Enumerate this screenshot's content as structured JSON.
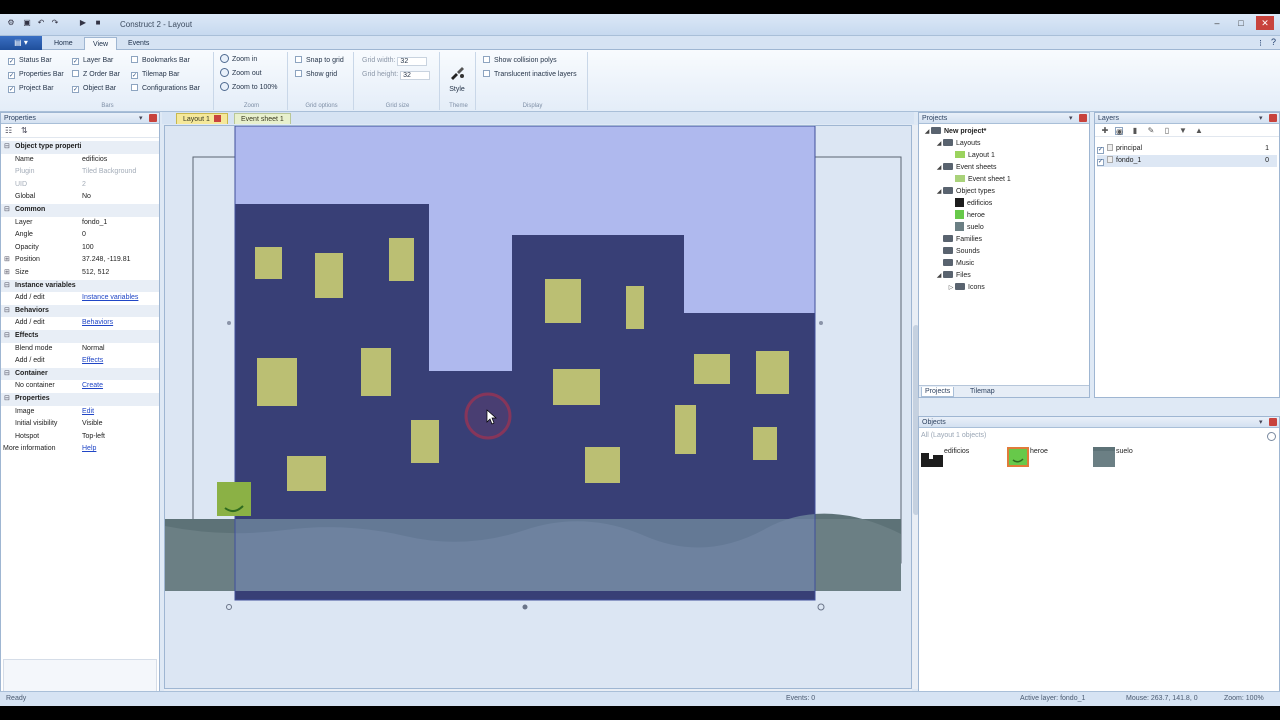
{
  "window": {
    "title": "Construct 2 - Layout"
  },
  "ribbon": {
    "tabs": [
      "Home",
      "View",
      "Events"
    ],
    "active_tab": "View",
    "groups": {
      "bars": {
        "title": "Bars",
        "items": [
          {
            "label": "Status Bar",
            "checked": true
          },
          {
            "label": "Layer Bar",
            "checked": true
          },
          {
            "label": "Bookmarks Bar",
            "checked": false
          },
          {
            "label": "Properties Bar",
            "checked": true
          },
          {
            "label": "Z Order Bar",
            "checked": false
          },
          {
            "label": "Tilemap Bar",
            "checked": true
          },
          {
            "label": "Project Bar",
            "checked": true
          },
          {
            "label": "Object Bar",
            "checked": true
          },
          {
            "label": "Configurations Bar",
            "checked": false
          }
        ]
      },
      "zoom": {
        "title": "Zoom",
        "items": [
          "Zoom in",
          "Zoom out",
          "Zoom to 100%"
        ]
      },
      "grid_options": {
        "title": "Grid options",
        "items": [
          {
            "label": "Snap to grid",
            "checked": false
          },
          {
            "label": "Show grid",
            "checked": false
          }
        ]
      },
      "grid_size": {
        "title": "Grid size",
        "width_label": "Grid width:",
        "width_value": "32",
        "height_label": "Grid height:",
        "height_value": "32"
      },
      "theme": {
        "title": "Theme",
        "style_label": "Style"
      },
      "display": {
        "title": "Display",
        "items": [
          {
            "label": "Show collision polys",
            "checked": false
          },
          {
            "label": "Translucent inactive layers",
            "checked": false
          }
        ]
      }
    }
  },
  "properties": {
    "title": "Properties",
    "rows": [
      {
        "type": "section",
        "name": "Object type properties"
      },
      {
        "name": "Name",
        "value": "edificios"
      },
      {
        "name": "Plugin",
        "value": "Tiled Background",
        "dim": true
      },
      {
        "name": "UID",
        "value": "2",
        "dim": true
      },
      {
        "name": "Global",
        "value": "No"
      },
      {
        "type": "section",
        "name": "Common"
      },
      {
        "name": "Layer",
        "value": "fondo_1"
      },
      {
        "name": "Angle",
        "value": "0"
      },
      {
        "name": "Opacity",
        "value": "100"
      },
      {
        "name": "Position",
        "value": "37.248, -119.81",
        "expand": true
      },
      {
        "name": "Size",
        "value": "512, 512",
        "expand": true
      },
      {
        "type": "section",
        "name": "Instance variables"
      },
      {
        "name": "Add / edit",
        "value": "Instance variables",
        "link": true
      },
      {
        "type": "section",
        "name": "Behaviors"
      },
      {
        "name": "Add / edit",
        "value": "Behaviors",
        "link": true
      },
      {
        "type": "section",
        "name": "Effects"
      },
      {
        "name": "Blend mode",
        "value": "Normal"
      },
      {
        "name": "Add / edit",
        "value": "Effects",
        "link": true
      },
      {
        "type": "section",
        "name": "Container"
      },
      {
        "name": "No container",
        "value": "Create",
        "link": true
      },
      {
        "type": "section",
        "name": "Properties"
      },
      {
        "name": "Image",
        "value": "Edit",
        "link": true
      },
      {
        "name": "Initial visibility",
        "value": "Visible"
      },
      {
        "name": "Hotspot",
        "value": "Top-left"
      },
      {
        "type": "info",
        "name": "More information",
        "value": "Help",
        "link": true
      }
    ]
  },
  "document_tabs": [
    {
      "label": "Layout 1",
      "active": true
    },
    {
      "label": "Event sheet 1",
      "active": false
    }
  ],
  "layout_view": {
    "colors": {
      "sky": "#c5cbf1",
      "buildings": "#20224c",
      "windows": "#d6d347",
      "ground": "#6b7f84",
      "outside": "#dce6f3"
    }
  },
  "projects": {
    "title": "Projects",
    "tree": [
      {
        "label": "New project*",
        "level": 0,
        "icon": "folder",
        "bold": true,
        "twisty": "◢"
      },
      {
        "label": "Layouts",
        "level": 1,
        "icon": "folder",
        "twisty": "◢"
      },
      {
        "label": "Layout 1",
        "level": 2,
        "icon": "layout"
      },
      {
        "label": "Event sheets",
        "level": 1,
        "icon": "folder",
        "twisty": "◢"
      },
      {
        "label": "Event sheet 1",
        "level": 2,
        "icon": "event"
      },
      {
        "label": "Object types",
        "level": 1,
        "icon": "folder",
        "twisty": "◢"
      },
      {
        "label": "edificios",
        "level": 2,
        "icon": "obj-edificios"
      },
      {
        "label": "heroe",
        "level": 2,
        "icon": "obj-heroe"
      },
      {
        "label": "suelo",
        "level": 2,
        "icon": "obj-suelo"
      },
      {
        "label": "Families",
        "level": 1,
        "icon": "folder"
      },
      {
        "label": "Sounds",
        "level": 1,
        "icon": "folder"
      },
      {
        "label": "Music",
        "level": 1,
        "icon": "folder"
      },
      {
        "label": "Files",
        "level": 1,
        "icon": "folder",
        "twisty": "◢"
      },
      {
        "label": "Icons",
        "level": 2,
        "icon": "folder",
        "twisty": "▷"
      }
    ],
    "tabs": [
      "Projects",
      "Tilemap"
    ]
  },
  "layers": {
    "title": "Layers",
    "rows": [
      {
        "name": "principal",
        "index": "1"
      },
      {
        "name": "fondo_1",
        "index": "0"
      }
    ]
  },
  "objects": {
    "title": "Objects",
    "filter": "All (Layout 1 objects)",
    "items": [
      "edificios",
      "heroe",
      "suelo"
    ]
  },
  "status": {
    "left": "Ready",
    "center": "Events: 0",
    "active_layer": "Active layer: fondo_1",
    "mouse": "Mouse: 263.7, 141.8, 0",
    "zoom": "Zoom: 100%"
  }
}
